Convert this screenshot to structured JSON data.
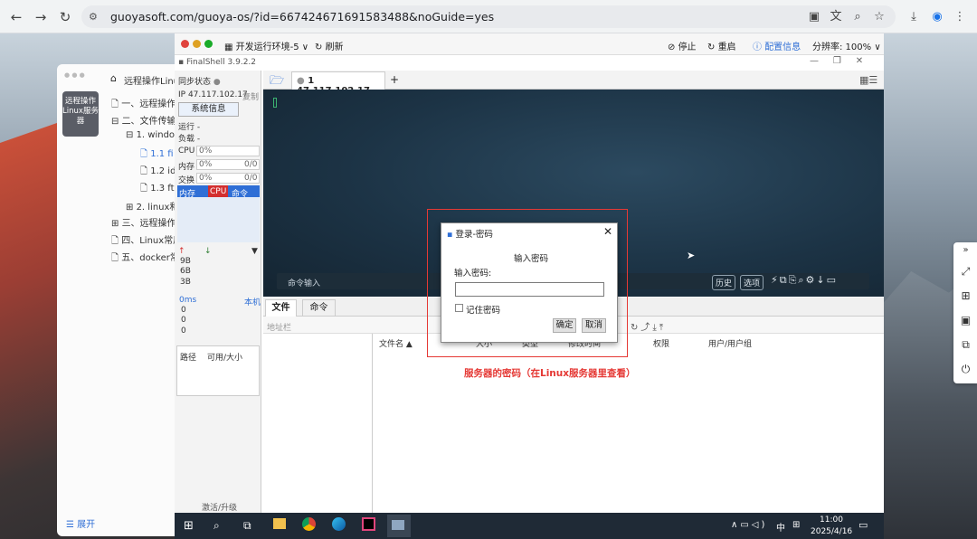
{
  "browser": {
    "url": "guoyasoft.com/guoya-os/?id=667424671691583488&noGuide=yes",
    "icons": [
      "back-icon",
      "forward-icon",
      "reload-icon",
      "site-settings-icon",
      "clipboard-icon",
      "translate-icon",
      "zoom-icon",
      "bookmark-star-icon",
      "download-icon",
      "profile-icon",
      "menu-icon"
    ]
  },
  "doc_app": {
    "icon_label": "远程操作Linux服务器",
    "title": "远程操作Linu",
    "tree": [
      "一、远程操作",
      "二、文件传输",
      "1. windov",
      "1.1 fi",
      "1.2 id",
      "1.3 ft",
      "2. linux和",
      "三、远程操作",
      "四、Linux常用",
      "五、docker常"
    ],
    "expand_label": "展开"
  },
  "env_bar": {
    "env": "开发运行环境-5",
    "refresh": "刷新",
    "stop": "停止",
    "restart": "重启",
    "config": "配置信息",
    "resolution": "分辨率: 100%"
  },
  "finalshell": {
    "title": "FinalShell 3.9.2.2",
    "sync": "同步状态",
    "ip": "IP 47.117.102.17",
    "copy": "复制",
    "sysinfo": "系统信息",
    "run": "运行 -",
    "load": "负载 -",
    "cpu_label": "CPU",
    "cpu_val": "0%",
    "mem_label": "内存",
    "mem_val": "0%",
    "mem_ratio": "0/0",
    "swap_label": "交换",
    "swap_val": "0%",
    "swap_ratio": "0/0",
    "proc_tabs": [
      "内存",
      "CPU",
      "命令"
    ],
    "net": [
      "9B",
      "6B",
      "3B"
    ],
    "latency": "0ms",
    "host": "本机",
    "lat_vals": [
      "0",
      "0",
      "0"
    ],
    "disk_path": "路径",
    "disk_size": "可用/大小",
    "activate": "激活/升级",
    "tab": "1 47.117.102.17",
    "cmd_input": "命令输入",
    "history": "历史",
    "options": "选项",
    "lower_tabs": [
      "文件",
      "命令"
    ],
    "address": "地址栏",
    "cols": [
      "文件名 ▲",
      "大小",
      "类型",
      "修改时间",
      "权限",
      "用户/用户组"
    ]
  },
  "dialog": {
    "title": "登录-密码",
    "heading": "输入密码",
    "field_label": "输入密码:",
    "password_value": "",
    "remember": "记住密码",
    "ok": "确定",
    "cancel": "取消"
  },
  "annotation": {
    "text": "服务器的密码（在Linux服务器里查看）"
  },
  "taskbar": {
    "time": "11:00",
    "date": "2025/4/16",
    "ime": "中"
  },
  "colors": {
    "annotation": "#e53935",
    "tab_active": "#d32f2f",
    "select": "#2f6fd6"
  }
}
